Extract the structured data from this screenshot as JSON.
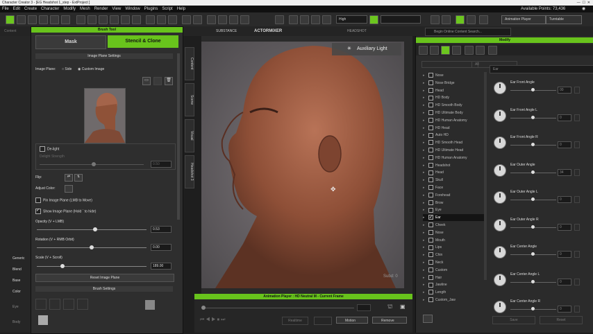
{
  "window": {
    "title": "Character Creator 3 - [EG Headshot 1_step - ExtProject ]"
  },
  "menu": [
    "File",
    "Edit",
    "Create",
    "Character",
    "Modify",
    "Mesh",
    "Render",
    "View",
    "Window",
    "Plugins",
    "Script",
    "Help"
  ],
  "header": {
    "available_points": "Available Points: 73,436",
    "animation_player": "Animation Player",
    "turntable": "Turntable",
    "quality": "High",
    "search_placeholder": "Begin Online Content Search..."
  },
  "brush_tool": {
    "title": "Brush Tool",
    "tabs": [
      "Mask",
      "Stencil & Clone"
    ],
    "image_plane_settings": "Image Plane Settings",
    "image_plane_label": "Image Plane:",
    "option_side": "Side",
    "option_custom": "Custom Image",
    "delight": "De-light",
    "delight_strength": "Delight Strength",
    "delight_value": "0.50",
    "flip": "Flip:",
    "adjust_color": "Adjust Color:",
    "pin_image": "Pin Image Plane (LMB to Move)",
    "show_image": "Show Image Plane (Hold ` to hide)",
    "opacity_label": "Opacity (V + LMB)",
    "opacity_value": "0.53",
    "opacity": 0.53,
    "rotation_label": "Rotation (V + RMB Orbit)",
    "rotation_value": "0.00",
    "scale_label": "Scale (V + Scroll)",
    "scale_value": "189.00",
    "reset": "Reset Image Plane",
    "brush_settings": "Brush Settings"
  },
  "left_side": {
    "items": [
      "Generic",
      "Blend",
      "Base",
      "Color"
    ],
    "eye": "Eye",
    "body": "Body",
    "tabs_top": [
      "Content"
    ]
  },
  "side_tabs": [
    "Content",
    "Scene",
    "Visual",
    "Headshot 3"
  ],
  "viewport": {
    "aux_light": "Auxiliary Light",
    "badge": "Subd: 0"
  },
  "player": {
    "title": "Animation Player : HD Neutral M - Current Frame",
    "realtime": "Realtime",
    "motion": "Motion",
    "remove": "Remove"
  },
  "modify": {
    "title": "Modify",
    "filter": "All",
    "search": "Ear",
    "tree": [
      "Nose",
      "Nose Bridge",
      "Head",
      "HD Body",
      "HD Smooth Body",
      "HD Ultimate Body",
      "HD Human Anatomy",
      "HD Head",
      "Auto HD",
      "HD Smooth Head",
      "HD Ultimate Head",
      "HD Human Anatomy",
      "Headshot",
      "Head",
      "Skull",
      "Face",
      "Forehead",
      "Brow",
      "Eye",
      "Ear",
      "Cheek",
      "Nose",
      "Mouth",
      "Lips",
      "Chin",
      "Neck",
      "Custom",
      "Hair",
      "Jawline",
      "Length",
      "Custom_Jaw"
    ],
    "morphs": [
      "Ear Front Angle",
      "Ear Front Angle L",
      "Ear Front Angle R",
      "Ear Outer Angle",
      "Ear Outer Angle L",
      "Ear Outer Angle R",
      "Ear Center Angle",
      "Ear Center Angle L",
      "Ear Center Angle R"
    ],
    "morph_values": [
      "00",
      "0",
      "0",
      "34",
      "0",
      "0",
      "0",
      "0",
      "0"
    ],
    "footer": [
      "Save",
      "Reset"
    ]
  }
}
